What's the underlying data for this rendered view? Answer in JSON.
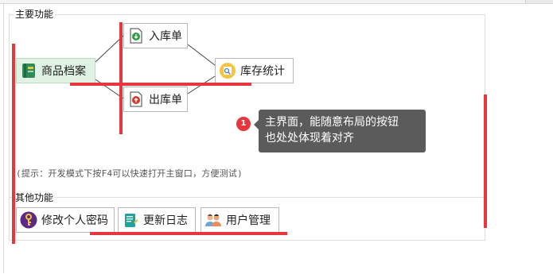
{
  "main_section": {
    "title": "主要功能",
    "buttons": {
      "goods_archive": {
        "label": "商品档案",
        "icon": "book-icon"
      },
      "stock_in": {
        "label": "入库单",
        "icon": "green-down-arrow-icon"
      },
      "stock_out": {
        "label": "出库单",
        "icon": "red-up-arrow-icon"
      },
      "inventory_stats": {
        "label": "库存统计",
        "icon": "stats-chart-icon"
      }
    },
    "hint": "(提示：开发模式下按F4可以快速打开主窗口，方便测试)"
  },
  "other_section": {
    "title": "其他功能",
    "buttons": {
      "change_password": {
        "label": "修改个人密码",
        "icon": "key-icon"
      },
      "update_log": {
        "label": "更新日志",
        "icon": "notebook-icon"
      },
      "user_management": {
        "label": "用户管理",
        "icon": "users-icon"
      }
    }
  },
  "annotation": {
    "badge": "1",
    "tooltip_line1": "主界面，能随意布局的按钮",
    "tooltip_line2": "也处处体现着对齐"
  },
  "colors": {
    "accent_red": "#e8363d",
    "selected_bg": "#dff2e3",
    "tooltip_bg": "#5b5b5b"
  }
}
